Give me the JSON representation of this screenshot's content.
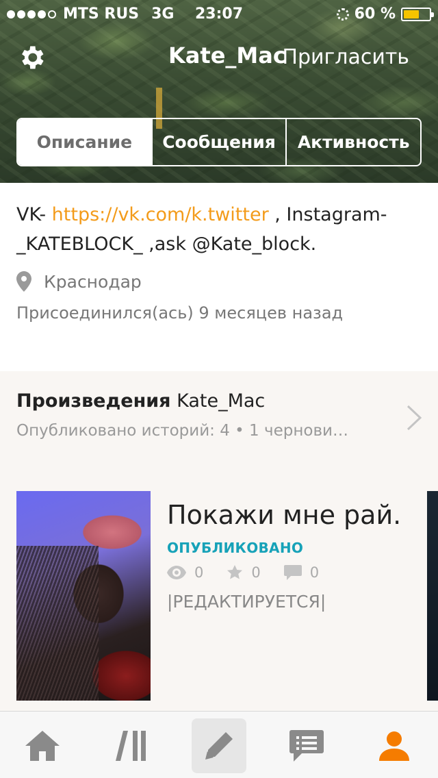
{
  "status_bar": {
    "carrier": "MTS RUS",
    "network": "3G",
    "time": "23:07",
    "battery": "60 %",
    "battery_level": 0.6,
    "signal_bars_filled": 4,
    "signal_bars_total": 5
  },
  "header": {
    "username": "Kate_Mac",
    "invite_label": "Пригласить",
    "settings_icon": "gear-icon",
    "tabs": [
      {
        "label": "Описание",
        "active": true
      },
      {
        "label": "Сообщения",
        "active": false
      },
      {
        "label": "Активность",
        "active": false
      }
    ]
  },
  "about": {
    "desc_prefix": "VK- ",
    "desc_link": "https://vk.com/k.twitter",
    "desc_suffix": " , Instagram- _KATEBLOCK_ ,ask @Kate_block.",
    "location": "Краснодар",
    "joined": "Присоединился(ась) 9 месяцев назад"
  },
  "works": {
    "title_bold": "Произведения",
    "title_name": " Kate_Mac",
    "subtitle": "Опубликовано историй: 4 • 1 чернови…",
    "story": {
      "title": "Покажи мне рай.",
      "status": "ОПУБЛИКОВАНО",
      "views": "0",
      "votes": "0",
      "comments": "0",
      "note": "|РЕДАКТИРУЕТСЯ|"
    }
  },
  "tabbar": {
    "items": [
      "home-icon",
      "library-icon",
      "write-icon",
      "messages-icon",
      "profile-icon"
    ],
    "active_color": "#f57c00",
    "icon_color": "#8a8a8a"
  }
}
